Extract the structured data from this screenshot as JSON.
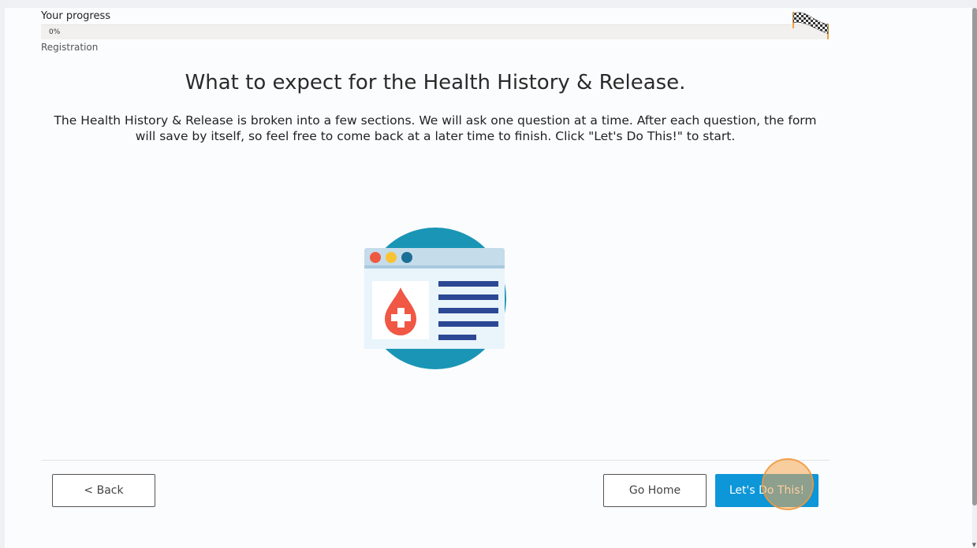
{
  "progress": {
    "label": "Your progress",
    "percent_text": "0%",
    "value": 0,
    "step": "Registration"
  },
  "main": {
    "heading": "What to expect for the Health History & Release.",
    "intro": "The Health History & Release is broken into a few sections. We will ask one question at a time. After each question, the form will save by itself, so feel free to come back at a later time to finish. Click \"Let's Do This!\" to start."
  },
  "illustration": {
    "icon": "medical-record-icon",
    "circle_color": "#1a95b5",
    "window_bar_color": "#c5dcea",
    "dot_colors": [
      "#ee5a41",
      "#f8c436",
      "#1a6f96"
    ],
    "drop_color": "#f05744",
    "line_color": "#2c4894"
  },
  "footer": {
    "back_label": "< Back",
    "home_label": "Go Home",
    "start_label": "Let's Do This!"
  },
  "colors": {
    "primary": "#0d96d8",
    "progress_fill": "#7ab55c"
  }
}
